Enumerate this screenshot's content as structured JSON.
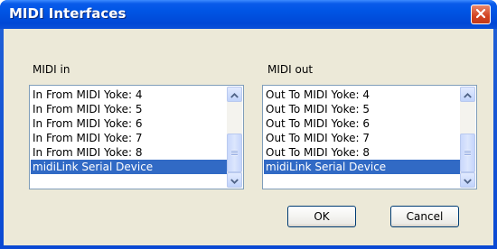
{
  "window": {
    "title": "MIDI Interfaces"
  },
  "midi_in": {
    "label": "MIDI in",
    "items": [
      {
        "label": "In From MIDI Yoke:  4",
        "selected": false
      },
      {
        "label": "In From MIDI Yoke:  5",
        "selected": false
      },
      {
        "label": "In From MIDI Yoke:  6",
        "selected": false
      },
      {
        "label": "In From MIDI Yoke:  7",
        "selected": false
      },
      {
        "label": "In From MIDI Yoke:  8",
        "selected": false
      },
      {
        "label": "midiLink Serial Device",
        "selected": true
      }
    ]
  },
  "midi_out": {
    "label": "MIDI out",
    "items": [
      {
        "label": "Out To MIDI Yoke:  4",
        "selected": false
      },
      {
        "label": "Out To MIDI Yoke:  5",
        "selected": false
      },
      {
        "label": "Out To MIDI Yoke:  6",
        "selected": false
      },
      {
        "label": "Out To MIDI Yoke:  7",
        "selected": false
      },
      {
        "label": "Out To MIDI Yoke:  8",
        "selected": false
      },
      {
        "label": "midiLink Serial Device",
        "selected": true
      }
    ]
  },
  "buttons": {
    "ok": "OK",
    "cancel": "Cancel"
  },
  "colors": {
    "selection": "#316ac5",
    "client": "#ece9d8",
    "titlebar": "#0055e5"
  },
  "icons": {
    "close": "close-icon",
    "up": "arrow-up-icon",
    "down": "arrow-down-icon"
  }
}
